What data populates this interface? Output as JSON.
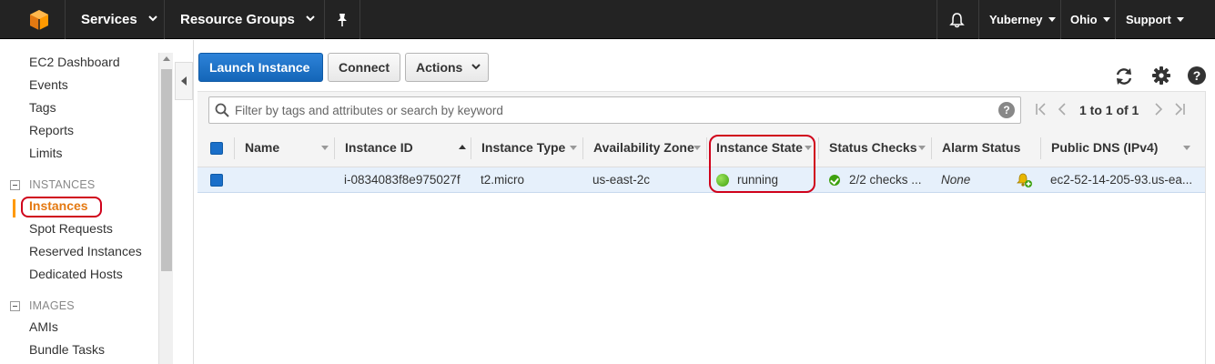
{
  "topnav": {
    "services": "Services",
    "resource_groups": "Resource Groups",
    "user": "Yuberney",
    "region": "Ohio",
    "support": "Support"
  },
  "sidebar": {
    "ec2_dashboard": "EC2 Dashboard",
    "events": "Events",
    "tags": "Tags",
    "reports": "Reports",
    "limits": "Limits",
    "instances_heading": "INSTANCES",
    "instances": "Instances",
    "spot_requests": "Spot Requests",
    "reserved_instances": "Reserved Instances",
    "dedicated_hosts": "Dedicated Hosts",
    "images_heading": "IMAGES",
    "amis": "AMIs",
    "bundle_tasks": "Bundle Tasks"
  },
  "toolbar": {
    "launch": "Launch Instance",
    "connect": "Connect",
    "actions": "Actions"
  },
  "filter": {
    "placeholder": "Filter by tags and attributes or search by keyword",
    "help": "?",
    "pagination": "1 to 1 of 1"
  },
  "table": {
    "headers": {
      "name": "Name",
      "instance_id": "Instance ID",
      "instance_type": "Instance Type",
      "availability_zone": "Availability Zone",
      "instance_state": "Instance State",
      "status_checks": "Status Checks",
      "alarm_status": "Alarm Status",
      "public_dns": "Public DNS (IPv4)"
    },
    "rows": [
      {
        "name": "",
        "instance_id": "i-0834083f8e975027f",
        "instance_type": "t2.micro",
        "availability_zone": "us-east-2c",
        "instance_state": "running",
        "status_checks": "2/2 checks ...",
        "alarm_status": "None",
        "public_dns": "ec2-52-14-205-93.us-ea..."
      }
    ]
  },
  "colors": {
    "nav_bg": "#232323",
    "primary": "#1a6fc9",
    "active_orange": "#e47911",
    "highlight_red": "#d0021b",
    "state_green": "#3ea10f"
  },
  "icons": [
    "aws-logo-icon",
    "pin-icon",
    "bell-icon",
    "refresh-icon",
    "gear-icon",
    "help-icon",
    "search-icon",
    "alarm-add-icon"
  ]
}
